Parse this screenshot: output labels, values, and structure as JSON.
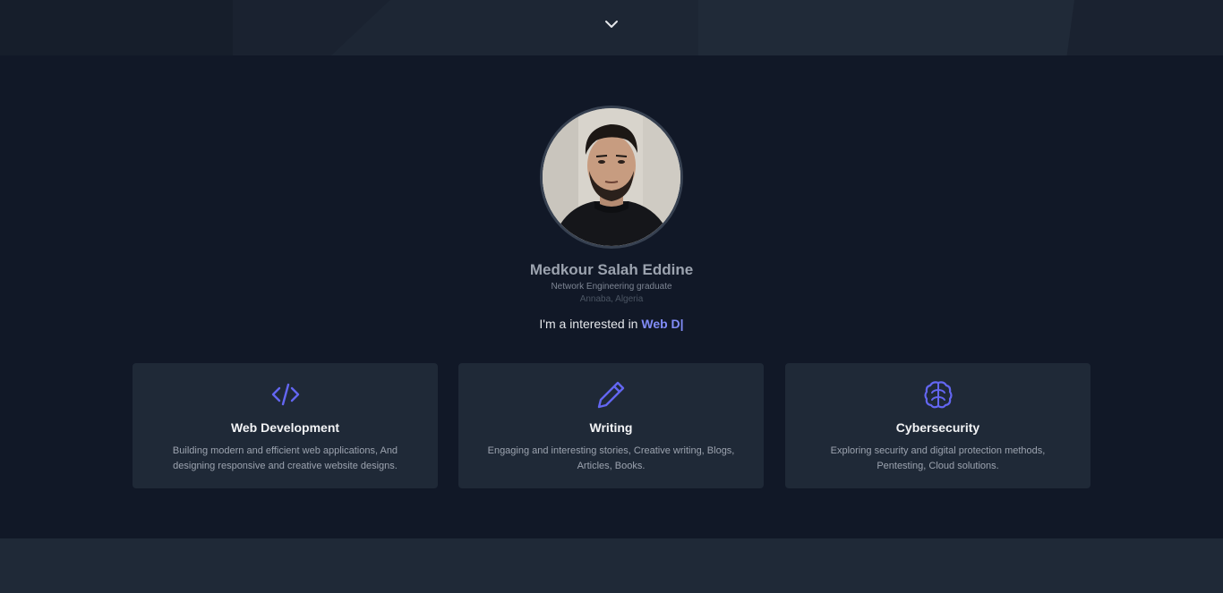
{
  "profile": {
    "name": "Medkour Salah Eddine",
    "subtitle": "Network Engineering graduate",
    "location": "Annaba, Algeria",
    "typed_prefix": "I'm a interested in ",
    "typed_value": "Web D|"
  },
  "cards": [
    {
      "icon": "code-icon",
      "title": "Web Development",
      "description": "Building modern and efficient web applications, And designing responsive and creative website designs."
    },
    {
      "icon": "pencil-icon",
      "title": "Writing",
      "description": "Engaging and interesting stories, Creative writing, Blogs, Articles, Books."
    },
    {
      "icon": "brain-icon",
      "title": "Cybersecurity",
      "description": "Exploring security and digital protection methods, Pentesting, Cloud solutions."
    }
  ],
  "colors": {
    "background": "#111827",
    "card": "#1f2937",
    "accent": "#818cf8",
    "icon": "#6366f1"
  }
}
